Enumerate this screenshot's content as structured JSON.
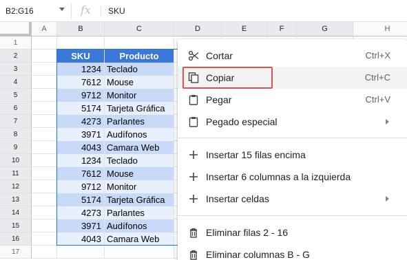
{
  "formula_bar": {
    "name_box": "B2:G16",
    "fx_label": "fx",
    "value": "SKU"
  },
  "columns": [
    "A",
    "B",
    "C",
    "D",
    "E",
    "F",
    "G",
    "H"
  ],
  "rows": [
    "1",
    "2",
    "3",
    "4",
    "5",
    "6",
    "7",
    "8",
    "9",
    "10",
    "11",
    "12",
    "13",
    "14",
    "15",
    "16",
    "17"
  ],
  "table": {
    "headers": {
      "sku": "SKU",
      "product": "Producto"
    },
    "rows": [
      {
        "sku": "1234",
        "product": "Teclado"
      },
      {
        "sku": "7612",
        "product": "Mouse"
      },
      {
        "sku": "9712",
        "product": "Monitor"
      },
      {
        "sku": "5174",
        "product": "Tarjeta Gráfica"
      },
      {
        "sku": "4273",
        "product": "Parlantes"
      },
      {
        "sku": "3971",
        "product": "Audífonos"
      },
      {
        "sku": "4043",
        "product": "Camara Web"
      },
      {
        "sku": "1234",
        "product": "Teclado"
      },
      {
        "sku": "7612",
        "product": "Mouse"
      },
      {
        "sku": "9712",
        "product": "Monitor"
      },
      {
        "sku": "5174",
        "product": "Tarjeta Gráfica"
      },
      {
        "sku": "4273",
        "product": "Parlantes"
      },
      {
        "sku": "3971",
        "product": "Audífonos"
      },
      {
        "sku": "4043",
        "product": "Camara Web"
      }
    ]
  },
  "context_menu": {
    "items": [
      {
        "label": "Cortar",
        "shortcut": "Ctrl+X",
        "icon": "scissors-icon"
      },
      {
        "label": "Copiar",
        "shortcut": "Ctrl+C",
        "icon": "copy-icon",
        "highlighted": true
      },
      {
        "label": "Pegar",
        "shortcut": "Ctrl+V",
        "icon": "clipboard-icon"
      },
      {
        "label": "Pegado especial",
        "icon": "clipboard-icon",
        "submenu": true
      },
      {
        "label": "Insertar 15 filas encima",
        "icon": "plus-icon"
      },
      {
        "label": "Insertar 6 columnas a la izquierda",
        "icon": "plus-icon"
      },
      {
        "label": "Insertar celdas",
        "icon": "plus-icon",
        "submenu": true
      },
      {
        "label": "Eliminar filas 2 - 16",
        "icon": "trash-icon"
      },
      {
        "label": "Eliminar columnas B - G",
        "icon": "trash-icon"
      }
    ]
  },
  "colors": {
    "header_fill": "#3c78d8",
    "band_dark": "#c9daf8",
    "band_light": "#e8f0fe",
    "selection": "#1a73e8",
    "callout": "#e0514d"
  }
}
